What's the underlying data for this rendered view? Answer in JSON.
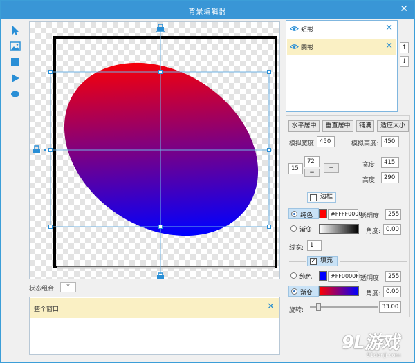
{
  "window": {
    "title": "背景编辑器",
    "close_glyph": "✕"
  },
  "toolbar": {
    "tools": [
      {
        "icon": "pointer-icon"
      },
      {
        "icon": "image-icon"
      },
      {
        "icon": "rectangle-icon"
      },
      {
        "icon": "triangle-icon"
      },
      {
        "icon": "ellipse-icon"
      }
    ]
  },
  "canvas": {
    "ellipse_gradient": {
      "from": "#FF0000",
      "to": "#0000FF"
    },
    "handle_color": "#2a8fd6"
  },
  "state": {
    "label": "状态组合:",
    "value": "*"
  },
  "window_panel": {
    "item": "整个窗口",
    "close_glyph": "✕"
  },
  "layers": {
    "items": [
      {
        "label": "矩形",
        "selected": false
      },
      {
        "label": "圆形",
        "selected": true
      }
    ],
    "close_glyph": "✕",
    "up_glyph": "↑",
    "down_glyph": "↓"
  },
  "props": {
    "align_buttons": [
      "水平居中",
      "垂直居中",
      "铺满",
      "适应大小"
    ],
    "sim_width_label": "模拟宽度:",
    "sim_width": "450",
    "sim_height_label": "模拟高度:",
    "sim_height": "450",
    "x_value": "15",
    "y_value": "72",
    "minus_glyph": "−",
    "width_label": "宽度:",
    "width": "415",
    "height_label": "高度:",
    "height": "290",
    "border": {
      "title": "边框",
      "checked": false,
      "solid_label": "纯色",
      "solid_color": "#FFFF0000",
      "solid_swatch": "#ff0000",
      "opacity_label": "透明度:",
      "opacity": "255",
      "gradient_label": "渐变",
      "angle_label": "角度:",
      "angle": "0.00",
      "line_width_label": "线宽:",
      "line_width": "1"
    },
    "fill": {
      "title": "填充",
      "checked": true,
      "check_glyph": "✓",
      "solid_label": "纯色",
      "solid_color": "#FF0000FF",
      "solid_swatch": "#0000ff",
      "opacity_label": "透明度:",
      "opacity": "255",
      "gradient_label": "渐变",
      "angle_label": "角度:",
      "angle": "0.00"
    },
    "rotate_label": "旋转:",
    "rotate": "33.00",
    "rotate_fraction": 0.092
  },
  "watermark": {
    "text": "9L游戏",
    "url": "91danji.com"
  }
}
